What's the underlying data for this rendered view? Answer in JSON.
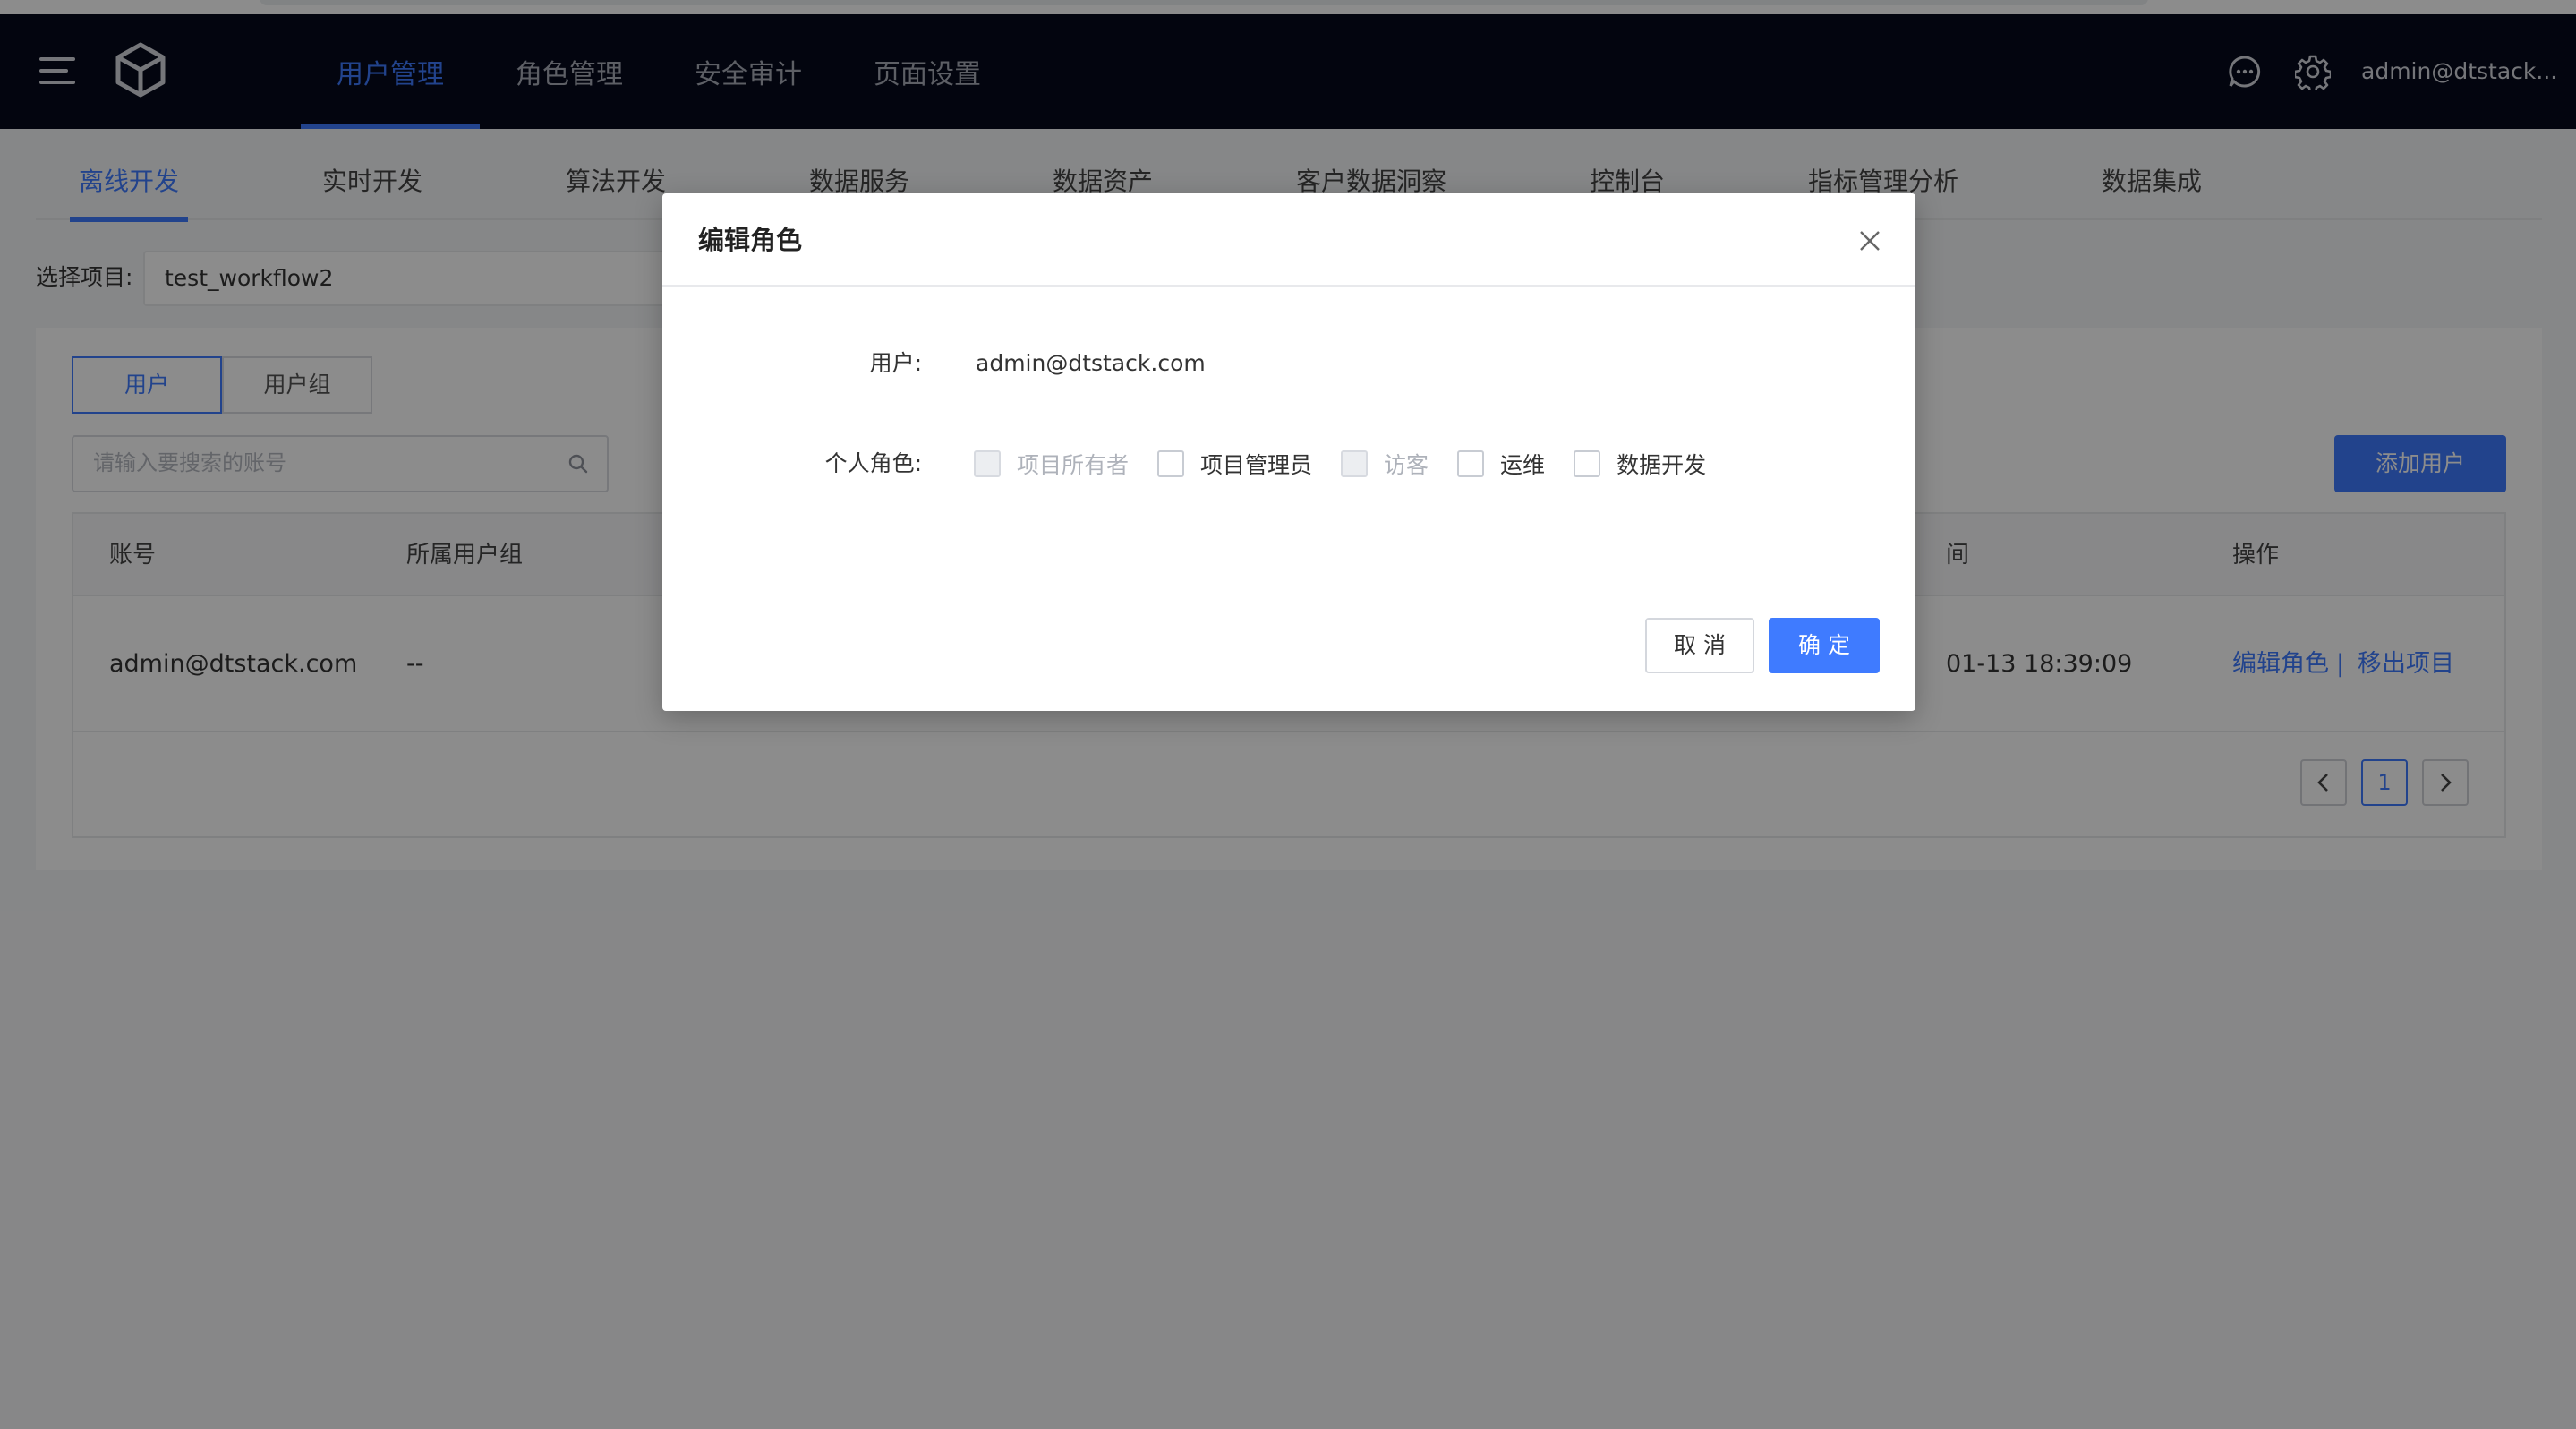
{
  "topbar": {
    "nav": [
      "用户管理",
      "角色管理",
      "安全审计",
      "页面设置"
    ],
    "active_nav": "用户管理",
    "account": "admin@dtstack..."
  },
  "subtabs": [
    "离线开发",
    "实时开发",
    "算法开发",
    "数据服务",
    "数据资产",
    "客户数据洞察",
    "控制台",
    "指标管理分析",
    "数据集成"
  ],
  "active_subtab": "离线开发",
  "project": {
    "label": "选择项目:",
    "value": "test_workflow2"
  },
  "panel": {
    "segments": [
      "用户",
      "用户组"
    ],
    "active_segment": "用户",
    "search_placeholder": "请输入要搜索的账号",
    "add_button": "添加用户",
    "table": {
      "headers": [
        "账号",
        "所属用户组",
        "间",
        "操作"
      ],
      "rows": [
        {
          "account": "admin@dtstack.com",
          "group": "--",
          "time": "01-13 18:39:09",
          "action_edit": "编辑角色",
          "separator": "|",
          "action_remove": "移出项目"
        }
      ]
    },
    "pager": {
      "prev": "‹",
      "current": "1",
      "next": "›"
    }
  },
  "modal": {
    "title": "编辑角色",
    "user_label": "用户:",
    "user_value": "admin@dtstack.com",
    "role_label": "个人角色:",
    "roles": [
      {
        "label": "项目所有者",
        "disabled": true,
        "checked": false
      },
      {
        "label": "项目管理员",
        "disabled": false,
        "checked": false
      },
      {
        "label": "访客",
        "disabled": true,
        "checked": false
      },
      {
        "label": "运维",
        "disabled": false,
        "checked": false
      },
      {
        "label": "数据开发",
        "disabled": false,
        "checked": false
      }
    ],
    "cancel": "取 消",
    "ok": "确 定"
  },
  "colors": {
    "accent": "#3f7bff",
    "topbar_bg": "#060a1c",
    "mask": "rgba(0,0,0,0.45)"
  }
}
